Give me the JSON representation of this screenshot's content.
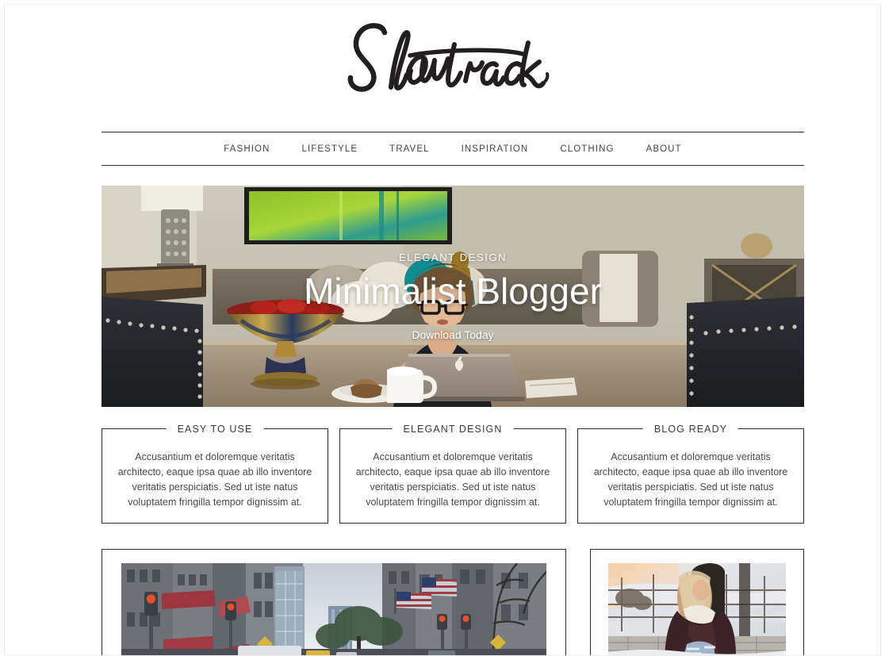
{
  "site": {
    "logo_text": "Showtrack",
    "logo_alt": "Showtrack handwritten script logo"
  },
  "nav": {
    "items": [
      {
        "label": "FASHION"
      },
      {
        "label": "LIFESTYLE"
      },
      {
        "label": "TRAVEL"
      },
      {
        "label": "INSPIRATION"
      },
      {
        "label": "CLOTHING"
      },
      {
        "label": "ABOUT"
      }
    ]
  },
  "hero": {
    "kicker": "ELEGANT DESIGN",
    "title": "Minimalist Blogger",
    "cta": "Download Today",
    "image_alt": "Woman in glasses working on a laptop at a dining table in an elegant interior"
  },
  "features": [
    {
      "title": "EASY TO USE",
      "body": "Accusantium et doloremque veritatis architecto, eaque ipsa quae ab illo inventore veritatis perspiciatis. Sed ut iste natus voluptatem fringilla tempor dignissim at."
    },
    {
      "title": "ELEGANT DESIGN",
      "body": "Accusantium et doloremque veritatis architecto, eaque ipsa quae ab illo inventore veritatis perspiciatis. Sed ut iste natus voluptatem fringilla tempor dignissim at."
    },
    {
      "title": "BLOG READY",
      "body": "Accusantium et doloremque veritatis architecto, eaque ipsa quae ab illo inventore veritatis perspiciatis. Sed ut iste natus voluptatem fringilla tempor dignissim at."
    }
  ],
  "cards": [
    {
      "image_alt": "City street canyon with tall buildings, traffic lights, red awnings and American flags"
    },
    {
      "image_alt": "Woman in a dark coat and ripped jeans sitting on a stone wall in a snowy landscape"
    }
  ],
  "colors": {
    "text": "#3d3d3d",
    "rule": "#2b2b2b",
    "background": "#ffffff",
    "hero_text": "#ffffff"
  }
}
